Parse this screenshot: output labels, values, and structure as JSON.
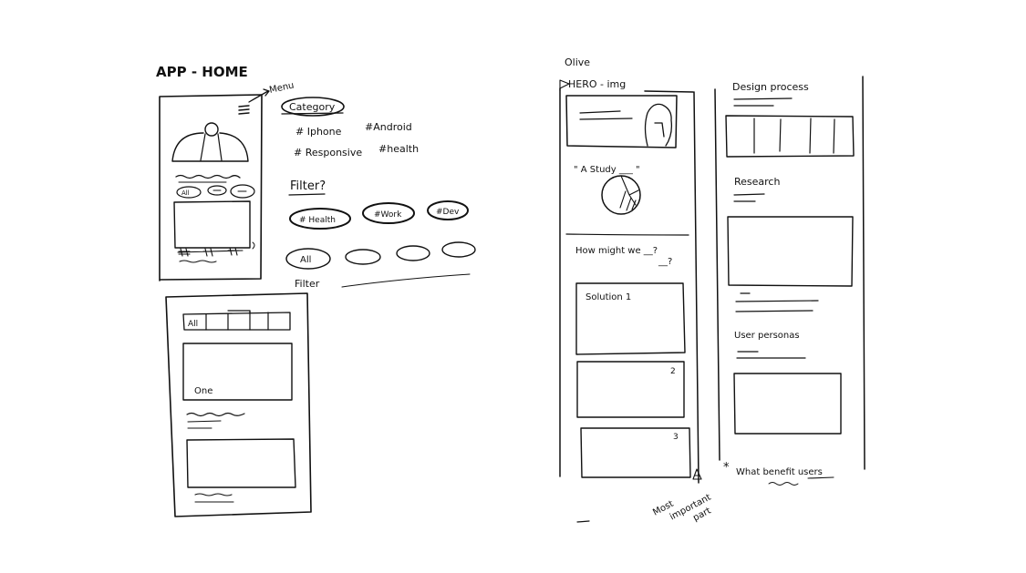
{
  "left": {
    "title": "APP - HOME",
    "menu_note": "Menu",
    "category_label": "Category",
    "tags": [
      "# Iphone",
      "#Android",
      "# Responsive",
      "#health"
    ],
    "filter_question": "Filter?",
    "filter_chips": [
      "# Health",
      "#Work",
      "#Dev"
    ],
    "all_chip": "All",
    "filter_bar_label": "Filter",
    "phone_chip_all": "All",
    "phone2_tab_all": "All",
    "phone2_card_label": "One"
  },
  "right": {
    "title": "Olive",
    "hero_label": "HERO - img",
    "quote": "\" A Study ___ \"",
    "hmw_line": "How might we __?",
    "hmw_q2": "__?",
    "solution_label": "Solution 1",
    "card2_num": "2",
    "card3_num": "3",
    "corner_a": "A",
    "design_process": "Design process",
    "research": "Research",
    "user_persona": "User personas",
    "benefit_note": "What benefit users",
    "important_note": [
      "Most",
      "important",
      "part"
    ]
  }
}
